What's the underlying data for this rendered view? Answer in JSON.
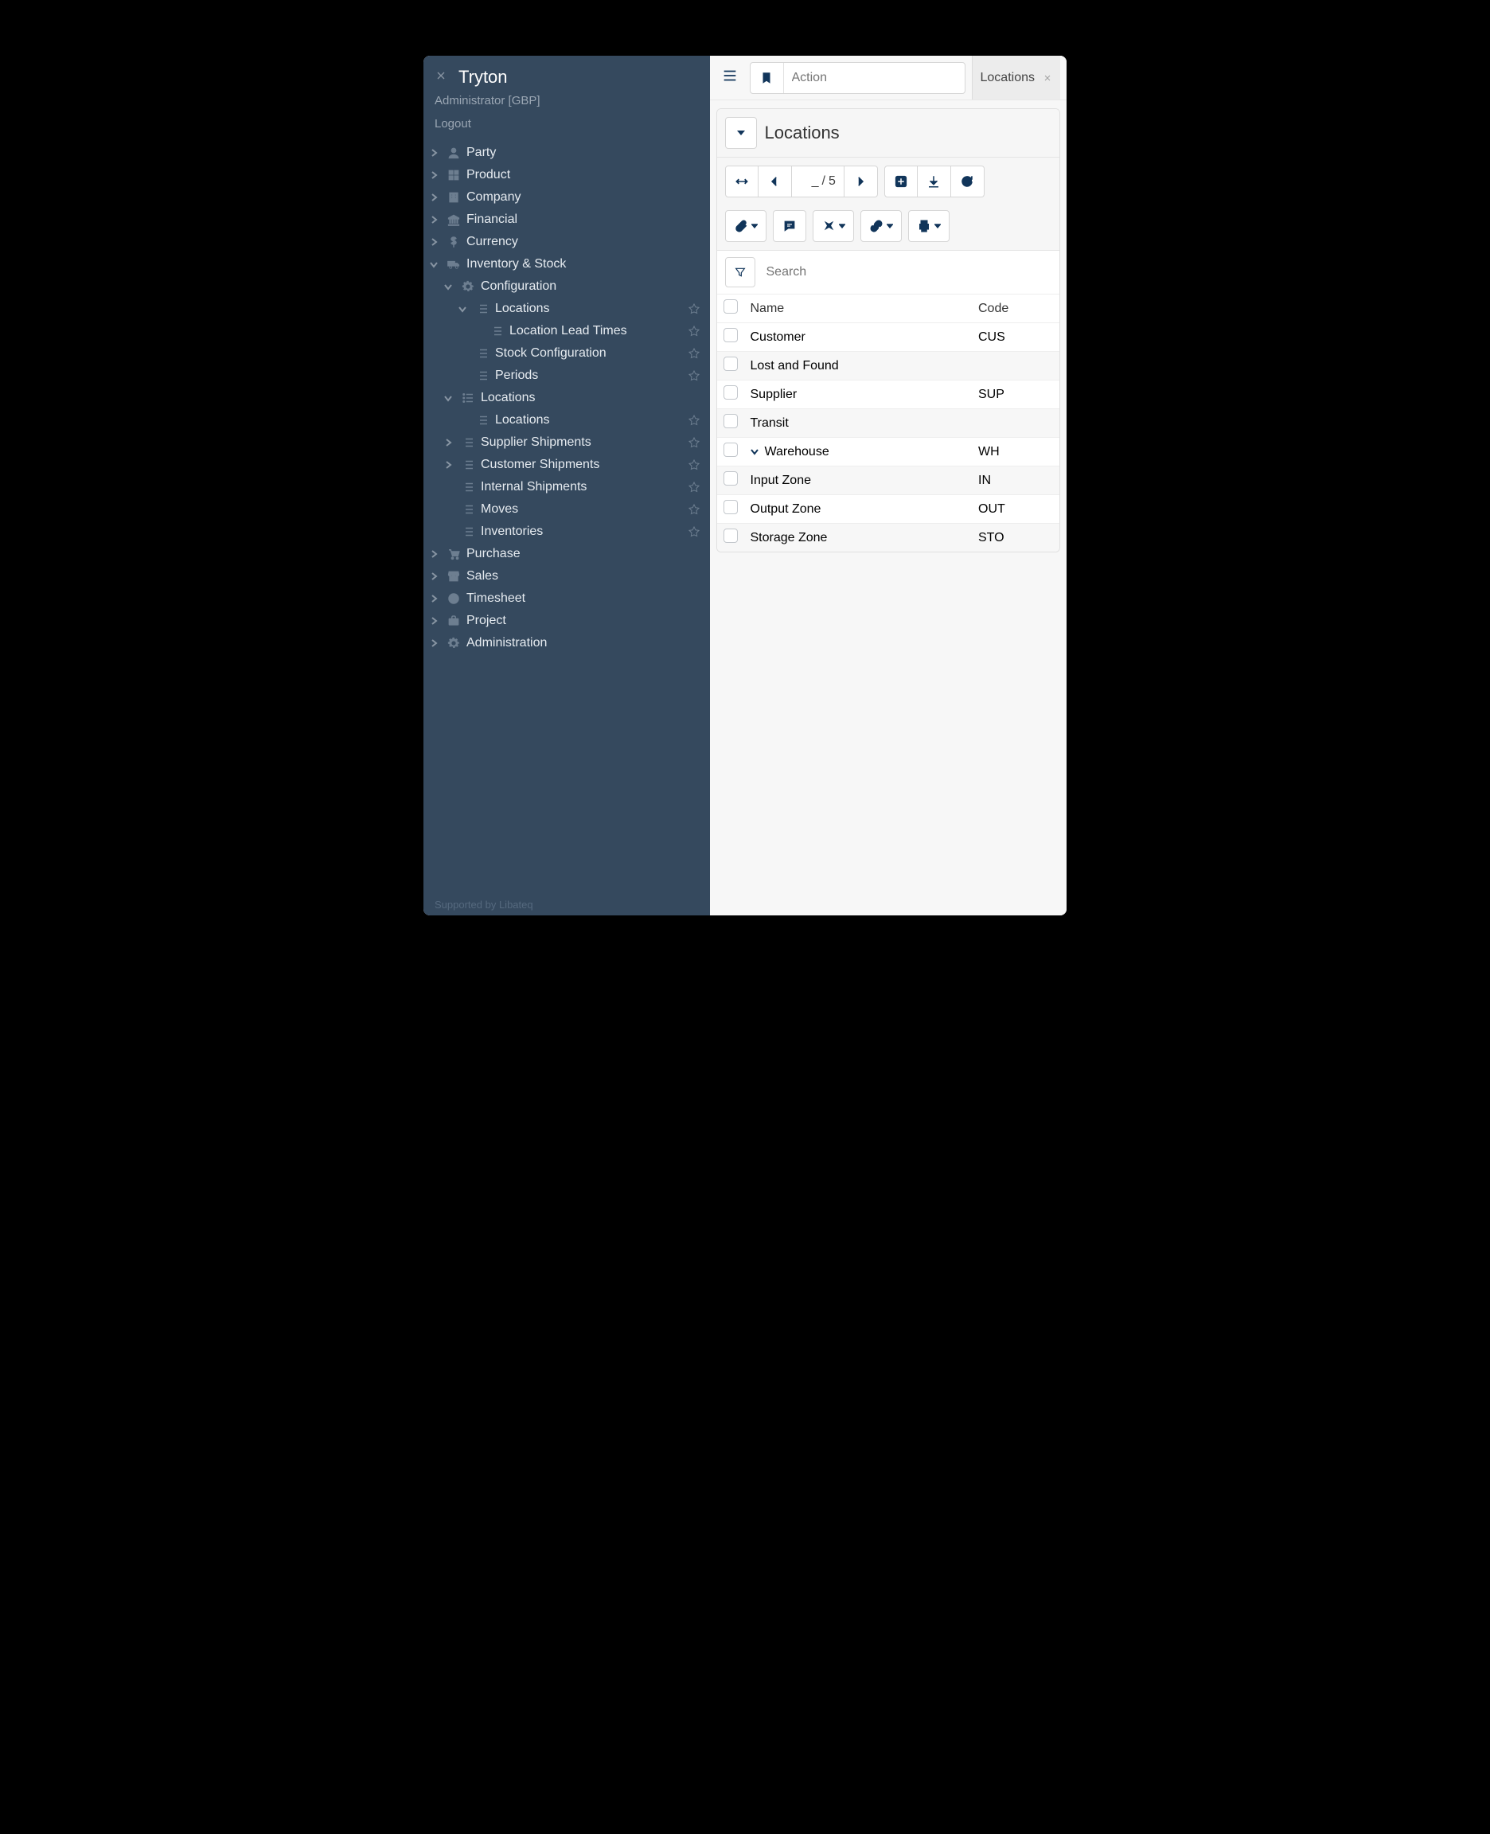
{
  "app": {
    "title": "Tryton",
    "user_line": "Administrator [GBP]",
    "logout": "Logout",
    "footer_prefix": "Supported by ",
    "footer_brand": "Libateq"
  },
  "nav": {
    "items": [
      {
        "label": "Party",
        "icon": "user",
        "expand": "right",
        "indent": 0
      },
      {
        "label": "Product",
        "icon": "grid",
        "expand": "right",
        "indent": 0
      },
      {
        "label": "Company",
        "icon": "building",
        "expand": "right",
        "indent": 0
      },
      {
        "label": "Financial",
        "icon": "bank",
        "expand": "right",
        "indent": 0
      },
      {
        "label": "Currency",
        "icon": "dollar",
        "expand": "right",
        "indent": 0
      },
      {
        "label": "Inventory & Stock",
        "icon": "truck",
        "expand": "down",
        "indent": 0
      },
      {
        "label": "Configuration",
        "icon": "gear",
        "expand": "down",
        "indent": 1
      },
      {
        "label": "Locations",
        "icon": "list",
        "expand": "down",
        "indent": 2,
        "star": true
      },
      {
        "label": "Location Lead Times",
        "icon": "list",
        "expand": "",
        "indent": 3,
        "star": true
      },
      {
        "label": "Stock Configuration",
        "icon": "list",
        "expand": "",
        "indent": 2,
        "star": true
      },
      {
        "label": "Periods",
        "icon": "list",
        "expand": "",
        "indent": 2,
        "star": true
      },
      {
        "label": "Locations",
        "icon": "list-dot",
        "expand": "down",
        "indent": 1
      },
      {
        "label": "Locations",
        "icon": "list",
        "expand": "",
        "indent": 2,
        "star": true
      },
      {
        "label": "Supplier Shipments",
        "icon": "list",
        "expand": "right",
        "indent": 1,
        "star": true
      },
      {
        "label": "Customer Shipments",
        "icon": "list",
        "expand": "right",
        "indent": 1,
        "star": true
      },
      {
        "label": "Internal Shipments",
        "icon": "list",
        "expand": "",
        "indent": 1,
        "star": true
      },
      {
        "label": "Moves",
        "icon": "list",
        "expand": "",
        "indent": 1,
        "star": true
      },
      {
        "label": "Inventories",
        "icon": "list",
        "expand": "",
        "indent": 1,
        "star": true
      },
      {
        "label": "Purchase",
        "icon": "cart",
        "expand": "right",
        "indent": 0
      },
      {
        "label": "Sales",
        "icon": "store",
        "expand": "right",
        "indent": 0
      },
      {
        "label": "Timesheet",
        "icon": "clock",
        "expand": "right",
        "indent": 0
      },
      {
        "label": "Project",
        "icon": "briefcase",
        "expand": "right",
        "indent": 0
      },
      {
        "label": "Administration",
        "icon": "gear",
        "expand": "right",
        "indent": 0
      }
    ]
  },
  "topbar": {
    "action_placeholder": "Action",
    "tab_label": "Locations"
  },
  "panel": {
    "title": "Locations",
    "page_current": "_",
    "page_sep": "/",
    "page_total": "5",
    "search_placeholder": "Search",
    "columns": {
      "name": "Name",
      "code": "Code"
    },
    "rows": [
      {
        "name": "Customer",
        "code": "CUS",
        "indent": 0,
        "alt": false
      },
      {
        "name": "Lost and Found",
        "code": "",
        "indent": 0,
        "alt": true
      },
      {
        "name": "Supplier",
        "code": "SUP",
        "indent": 0,
        "alt": false
      },
      {
        "name": "Transit",
        "code": "",
        "indent": 0,
        "alt": true
      },
      {
        "name": "Warehouse",
        "code": "WH",
        "indent": 0,
        "alt": false,
        "toggle": "down"
      },
      {
        "name": "Input Zone",
        "code": "IN",
        "indent": 1,
        "alt": true
      },
      {
        "name": "Output Zone",
        "code": "OUT",
        "indent": 1,
        "alt": false
      },
      {
        "name": "Storage Zone",
        "code": "STO",
        "indent": 1,
        "alt": true
      }
    ]
  }
}
